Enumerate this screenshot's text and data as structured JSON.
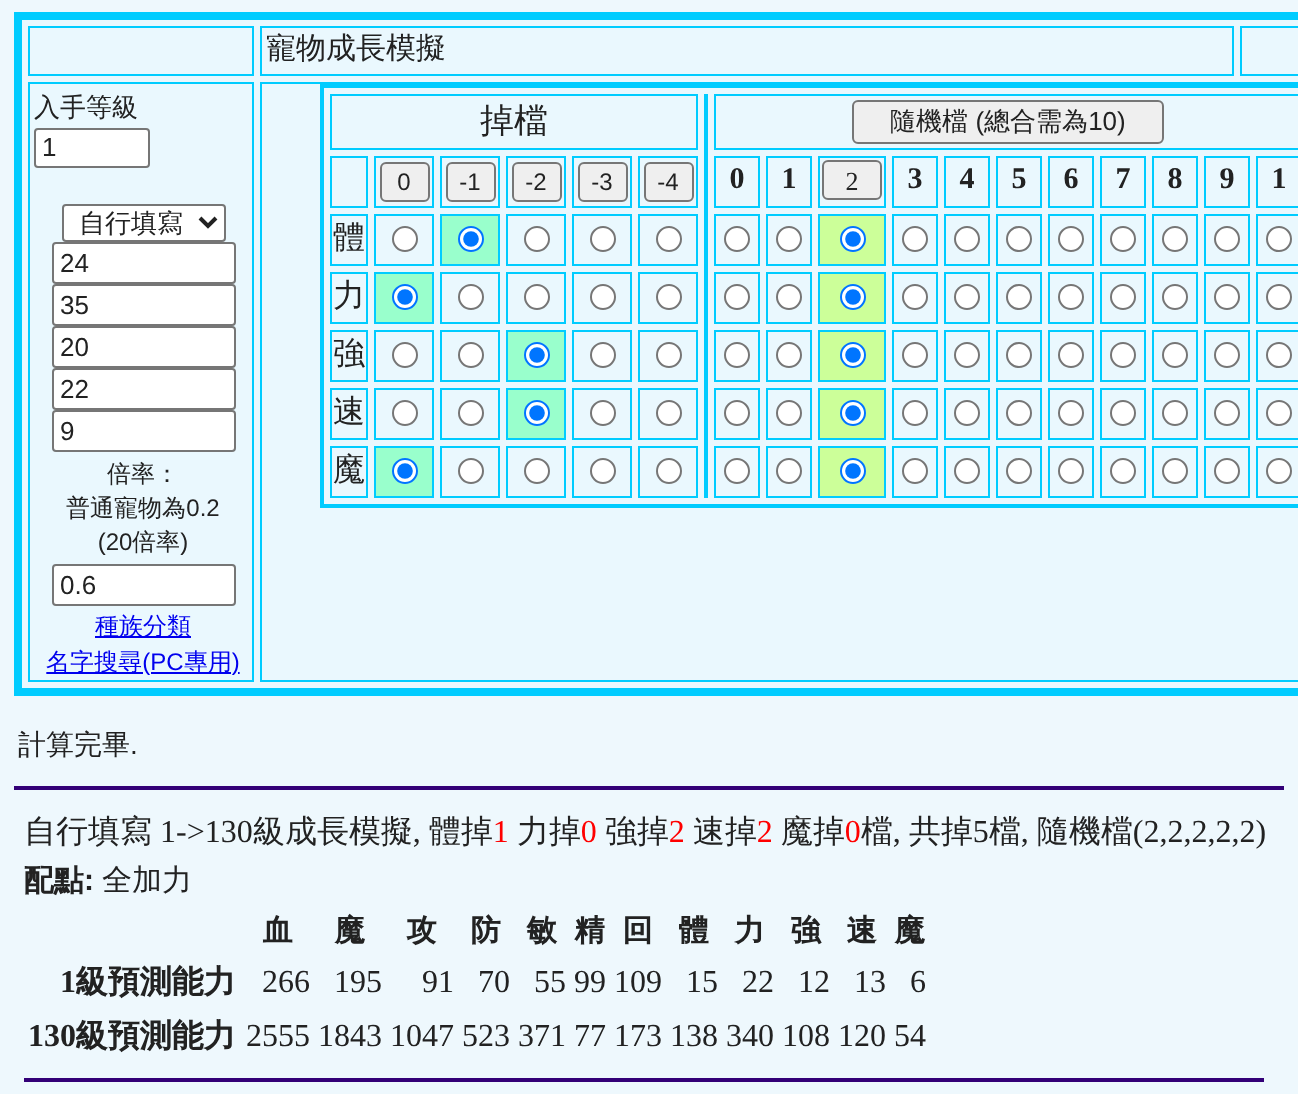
{
  "header": {
    "title": "寵物成長模擬"
  },
  "left_panel": {
    "level_label": "入手等級",
    "level_value": "1",
    "mode_select": "自行填寫",
    "stat_inputs": [
      "24",
      "35",
      "20",
      "22",
      "9"
    ],
    "rate_notes": [
      "倍率：",
      "普通寵物為0.2",
      "(20倍率)"
    ],
    "rate_value": "0.6",
    "links": [
      "種族分類",
      "名字搜尋(PC專用)"
    ]
  },
  "grid": {
    "drop_title": "掉檔",
    "random_button": "隨機檔 (總合需為10)",
    "drop_columns": [
      "0",
      "-1",
      "-2",
      "-3",
      "-4"
    ],
    "random_columns": [
      {
        "label": "0",
        "kind": "number"
      },
      {
        "label": "1",
        "kind": "number"
      },
      {
        "label": "2",
        "kind": "button"
      },
      {
        "label": "3",
        "kind": "number"
      },
      {
        "label": "4",
        "kind": "number"
      },
      {
        "label": "5",
        "kind": "number"
      },
      {
        "label": "6",
        "kind": "number"
      },
      {
        "label": "7",
        "kind": "number"
      },
      {
        "label": "8",
        "kind": "number"
      },
      {
        "label": "9",
        "kind": "number"
      },
      {
        "label": "1",
        "kind": "number"
      }
    ],
    "rows": [
      {
        "label": "體",
        "drop": [
          {
            "selected": false
          },
          {
            "selected": true
          },
          {
            "selected": false
          },
          {
            "selected": false
          },
          {
            "selected": false
          }
        ],
        "random": [
          {
            "selected": false
          },
          {
            "selected": false
          },
          {
            "selected": true
          },
          {
            "selected": false
          },
          {
            "selected": false
          },
          {
            "selected": false
          },
          {
            "selected": false
          },
          {
            "selected": false
          },
          {
            "selected": false
          },
          {
            "selected": false
          },
          {
            "selected": false
          }
        ]
      },
      {
        "label": "力",
        "drop": [
          {
            "selected": true
          },
          {
            "selected": false
          },
          {
            "selected": false
          },
          {
            "selected": false
          },
          {
            "selected": false
          }
        ],
        "random": [
          {
            "selected": false
          },
          {
            "selected": false
          },
          {
            "selected": true
          },
          {
            "selected": false
          },
          {
            "selected": false
          },
          {
            "selected": false
          },
          {
            "selected": false
          },
          {
            "selected": false
          },
          {
            "selected": false
          },
          {
            "selected": false
          },
          {
            "selected": false
          }
        ]
      },
      {
        "label": "強",
        "drop": [
          {
            "selected": false
          },
          {
            "selected": false
          },
          {
            "selected": true
          },
          {
            "selected": false
          },
          {
            "selected": false
          }
        ],
        "random": [
          {
            "selected": false
          },
          {
            "selected": false
          },
          {
            "selected": true
          },
          {
            "selected": false
          },
          {
            "selected": false
          },
          {
            "selected": false
          },
          {
            "selected": false
          },
          {
            "selected": false
          },
          {
            "selected": false
          },
          {
            "selected": false
          },
          {
            "selected": false
          }
        ]
      },
      {
        "label": "速",
        "drop": [
          {
            "selected": false
          },
          {
            "selected": false
          },
          {
            "selected": true
          },
          {
            "selected": false
          },
          {
            "selected": false
          }
        ],
        "random": [
          {
            "selected": false
          },
          {
            "selected": false
          },
          {
            "selected": true
          },
          {
            "selected": false
          },
          {
            "selected": false
          },
          {
            "selected": false
          },
          {
            "selected": false
          },
          {
            "selected": false
          },
          {
            "selected": false
          },
          {
            "selected": false
          },
          {
            "selected": false
          }
        ]
      },
      {
        "label": "魔",
        "drop": [
          {
            "selected": true
          },
          {
            "selected": false
          },
          {
            "selected": false
          },
          {
            "selected": false
          },
          {
            "selected": false
          }
        ],
        "random": [
          {
            "selected": false
          },
          {
            "selected": false
          },
          {
            "selected": true
          },
          {
            "selected": false
          },
          {
            "selected": false
          },
          {
            "selected": false
          },
          {
            "selected": false
          },
          {
            "selected": false
          },
          {
            "selected": false
          },
          {
            "selected": false
          },
          {
            "selected": false
          }
        ]
      }
    ]
  },
  "status": "計算完畢.",
  "summary": [
    {
      "text": "自行填寫 1->130級成長模擬, 體掉",
      "highlight": false
    },
    {
      "text": "1",
      "highlight": true
    },
    {
      "text": " 力掉",
      "highlight": false
    },
    {
      "text": "0",
      "highlight": true
    },
    {
      "text": " 強掉",
      "highlight": false
    },
    {
      "text": "2",
      "highlight": true
    },
    {
      "text": " 速掉",
      "highlight": false
    },
    {
      "text": "2",
      "highlight": true
    },
    {
      "text": " 魔掉",
      "highlight": false
    },
    {
      "text": "0",
      "highlight": true
    },
    {
      "text": "檔, 共掉5檔, 隨機檔(2,2,2,2,2)",
      "highlight": false
    }
  ],
  "allocation": "**配點:** 全加力",
  "stats_table": {
    "columns": [
      "血",
      "魔",
      "攻",
      "防",
      "敏",
      "精",
      "回",
      "體",
      "力",
      "強",
      "速",
      "魔"
    ],
    "rows": [
      {
        "label": "1級預測能力",
        "values": [
          "266",
          "195",
          "91",
          "70",
          "55",
          "99",
          "109",
          "15",
          "22",
          "12",
          "13",
          "6"
        ]
      },
      {
        "label": "130級預測能力",
        "values": [
          "2555",
          "1843",
          "1047",
          "523",
          "371",
          "77",
          "173",
          "138",
          "340",
          "108",
          "120",
          "54"
        ]
      }
    ]
  }
}
